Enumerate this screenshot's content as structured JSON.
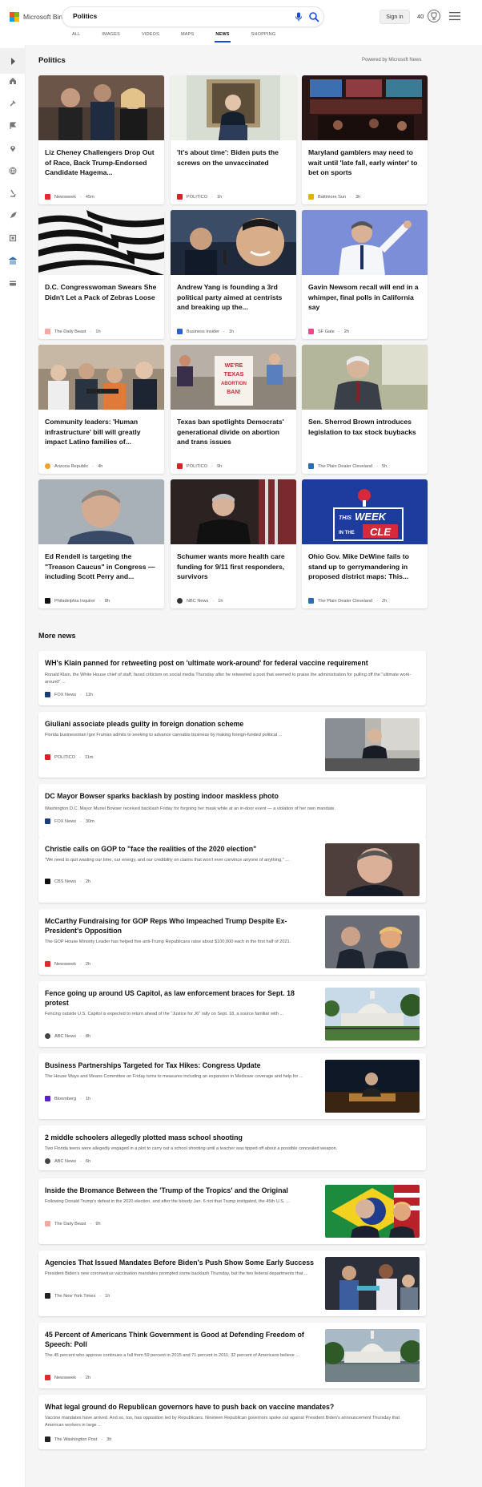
{
  "header": {
    "logo_text": "Microsoft Bing",
    "search_value": "Politics",
    "signin_label": "Sign in",
    "rewards_count": "40",
    "logo_colors": [
      "#f25022",
      "#7fba00",
      "#00a4ef",
      "#ffb900"
    ],
    "accent_color": "#174ae4"
  },
  "tabs": [
    {
      "label": "ALL",
      "active": false
    },
    {
      "label": "IMAGES",
      "active": false
    },
    {
      "label": "VIDEOS",
      "active": false
    },
    {
      "label": "MAPS",
      "active": false
    },
    {
      "label": "NEWS",
      "active": true
    },
    {
      "label": "SHOPPING",
      "active": false
    }
  ],
  "sidebar_icons": [
    "sidebar-toggle-icon",
    "home-icon",
    "tools-icon",
    "flag-icon",
    "location-pin-icon",
    "globe-icon",
    "microscope-icon",
    "rocket-icon",
    "film-icon",
    "bank-icon",
    "wallet-icon"
  ],
  "main": {
    "title": "Politics",
    "powered_by": "Powered by Microsoft News",
    "more_news_title": "More news"
  },
  "cards": [
    {
      "title": "Liz Cheney Challengers Drop Out of Race, Back Trump-Endorsed Candidate Hagema...",
      "source": "Newsweek",
      "time": "45m",
      "logo_color": "#e8272c"
    },
    {
      "title": "'It's about time': Biden puts the screws on the unvaccinated",
      "source": "POLITICO",
      "time": "1h",
      "logo_color": "#dc1f26"
    },
    {
      "title": "Maryland gamblers may need to wait until 'late fall, early winter' to bet on sports",
      "source": "Baltimore Sun",
      "time": "3h",
      "logo_color": "#e0b200"
    },
    {
      "title": "D.C. Congresswoman Swears She Didn't Let a Pack of Zebras Loose",
      "source": "The Daily Beast",
      "time": "1h",
      "logo_color": "#f4a9a0"
    },
    {
      "title": "Andrew Yang is founding a 3rd political party aimed at centrists and breaking up the...",
      "source": "Business Insider",
      "time": "1h",
      "logo_color": "#2b5fd9"
    },
    {
      "title": "Gavin Newsom recall will end in a whimper, final polls in California say",
      "source": "SF Gate",
      "time": "2h",
      "logo_color": "#e44d8a"
    },
    {
      "title": "Community leaders: 'Human infrastructure' bill will greatly impact Latino families of...",
      "source": "Arizona Republic",
      "time": "4h",
      "logo_color": "#f0a12a"
    },
    {
      "title": "Texas ban spotlights Democrats' generational divide on abortion and trans issues",
      "source": "POLITICO",
      "time": "9h",
      "logo_color": "#dc1f26"
    },
    {
      "title": "Sen. Sherrod Brown introduces legislation to tax stock buybacks",
      "source": "The Plain Dealer Cleveland",
      "time": "5h",
      "logo_color": "#2a6db5"
    },
    {
      "title": "Ed Rendell is targeting the \"Treason Caucus\" in Congress — including Scott Perry and...",
      "source": "Philadelphia Inquirer",
      "time": "8h",
      "logo_color": "#111111"
    },
    {
      "title": "Schumer wants more health care funding for 9/11 first responders, survivors",
      "source": "NBC News",
      "time": "1h",
      "logo_color": "#333333"
    },
    {
      "title": "Ohio Gov. Mike DeWine fails to stand up to gerrymandering in proposed district maps: This...",
      "source": "The Plain Dealer Cleveland",
      "time": "2h",
      "logo_color": "#2a6db5"
    }
  ],
  "more_news": [
    {
      "title": "WH's Klain panned for retweeting post on 'ultimate work-around' for federal vaccine requirement",
      "snippet": "Ronald Klain, the White House chief of staff, faced criticism on social media Thursday after he retweeted a post that seemed to praise the administration for pulling off the \"ultimate work-around\" ...",
      "source": "FOX News",
      "time": "11h",
      "logo_color": "#1a3c7a",
      "has_thumb": false
    },
    {
      "title": "Giuliani associate pleads guilty in foreign donation scheme",
      "snippet": "Florida businessman Igor Fruman admits to seeking to advance cannabis business by making foreign-funded political ...",
      "source": "POLITICO",
      "time": "11m",
      "logo_color": "#dc1f26",
      "has_thumb": true
    },
    {
      "title": "DC Mayor Bowser sparks backlash by posting indoor maskless photo",
      "snippet": "Washington D.C. Mayor Muriel Bowser received backlash Friday for forgoing her mask while at an in-door event — a violation of her own mandate.",
      "source": "FOX News",
      "time": "30m",
      "logo_color": "#1a3c7a",
      "has_thumb": false
    },
    {
      "title": "Christie calls on GOP to \"face the realities of the 2020 election\"",
      "snippet": "\"We need to quit wasting our time, our energy, and our credibility on claims that won't ever convince anyone of anything,\" ...",
      "source": "CBS News",
      "time": "2h",
      "logo_color": "#111111",
      "has_thumb": true
    },
    {
      "title": "McCarthy Fundraising for GOP Reps Who Impeached Trump Despite Ex-President's Opposition",
      "snippet": "The GOP House Minority Leader has helped five anti-Trump Republicans raise about $100,000 each in the first half of 2021.",
      "source": "Newsweek",
      "time": "2h",
      "logo_color": "#e8272c",
      "has_thumb": true
    },
    {
      "title": "Fence going up around US Capitol, as law enforcement braces for Sept. 18 protest",
      "snippet": "Fencing outside U.S. Capitol is expected to return ahead of the \"Justice for J6\" rally on Sept. 18, a source familiar with ...",
      "source": "ABC News",
      "time": "8h",
      "logo_color": "#444444",
      "has_thumb": true
    },
    {
      "title": "Business Partnerships Targeted for Tax Hikes: Congress Update",
      "snippet": "The House Ways and Means Committee on Friday turns to measures including an expansion in Medicare coverage and help for ...",
      "source": "Bloomberg",
      "time": "1h",
      "logo_color": "#5a1fd0",
      "has_thumb": true
    },
    {
      "title": "2 middle schoolers allegedly plotted mass school shooting",
      "snippet": "Two Florida teens were allegedly engaged in a plot to carry out a school shooting until a teacher was tipped off about a possible concealed weapon.",
      "source": "ABC News",
      "time": "6h",
      "logo_color": "#444444",
      "has_thumb": false
    },
    {
      "title": "Inside the Bromance Between the 'Trump of the Tropics' and the Original",
      "snippet": "Following Donald Trump's defeat in the 2020 election, and after the bloody Jan. 6 riot that Trump instigated, the 45th U.S. ...",
      "source": "The Daily Beast",
      "time": "9h",
      "logo_color": "#f4a9a0",
      "has_thumb": true
    },
    {
      "title": "Agencies That Issued Mandates Before Biden's Push Show Some Early Success",
      "snippet": "President Biden's new coronavirus vaccination mandates prompted some backlash Thursday, but the two federal departments that ...",
      "source": "The New York Times",
      "time": "1h",
      "logo_color": "#222222",
      "has_thumb": true
    },
    {
      "title": "45 Percent of Americans Think Government is Good at Defending Freedom of Speech: Poll",
      "snippet": "The 45 percent who approve continues a fall from 59 percent in 2015 and 71 percent in 2011; 32 percent of Americans believe ...",
      "source": "Newsweek",
      "time": "2h",
      "logo_color": "#e8272c",
      "has_thumb": true
    },
    {
      "title": "What legal ground do Republican governors have to push back on vaccine mandates?",
      "snippet": "Vaccine mandates have arrived. And so, too, has opposition led by Republicans. Nineteen Republican governors spoke out against President Biden's announcement Thursday that American workers in large ...",
      "source": "The Washington Post",
      "time": "3h",
      "logo_color": "#222222",
      "has_thumb": false
    }
  ],
  "thumb_text": {
    "week_line1": "THIS",
    "week_line2": "WEEK",
    "week_line3": "IN THE",
    "week_line4": "CLE",
    "sign_line1": "WE'RE",
    "sign_line2": "TEXAS",
    "sign_line3": "ABORTION",
    "sign_line4": "BAN!"
  }
}
